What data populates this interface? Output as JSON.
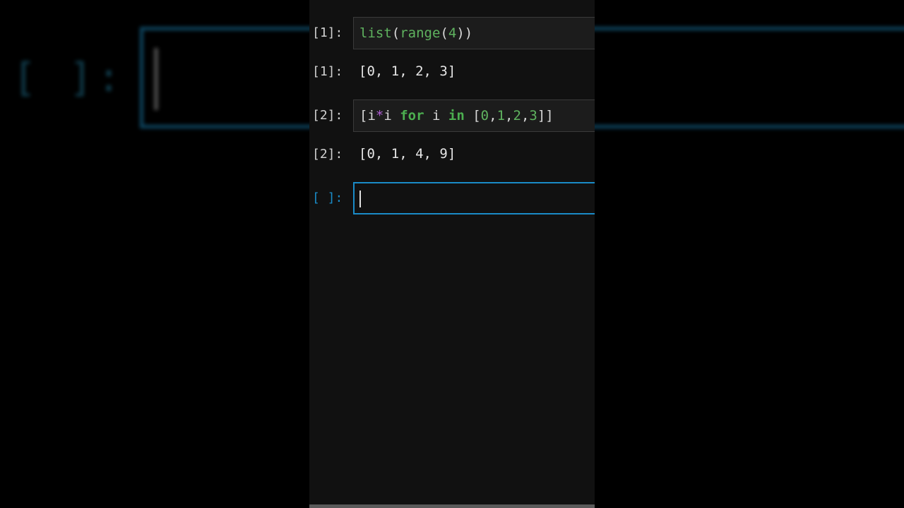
{
  "background": {
    "prompt": "[ ]:"
  },
  "cells": [
    {
      "input_prompt": "[1]:",
      "input_tokens": [
        {
          "text": "list",
          "cls": "tok-builtin"
        },
        {
          "text": "(",
          "cls": "tok-plain"
        },
        {
          "text": "range",
          "cls": "tok-builtin"
        },
        {
          "text": "(",
          "cls": "tok-plain"
        },
        {
          "text": "4",
          "cls": "tok-num"
        },
        {
          "text": "))",
          "cls": "tok-plain"
        }
      ],
      "output_prompt": "[1]:",
      "output": "[0, 1, 2, 3]"
    },
    {
      "input_prompt": "[2]:",
      "input_tokens": [
        {
          "text": "[i",
          "cls": "tok-plain"
        },
        {
          "text": "*",
          "cls": "tok-op"
        },
        {
          "text": "i ",
          "cls": "tok-plain"
        },
        {
          "text": "for",
          "cls": "tok-kw"
        },
        {
          "text": " i ",
          "cls": "tok-plain"
        },
        {
          "text": "in",
          "cls": "tok-kw"
        },
        {
          "text": " [",
          "cls": "tok-plain"
        },
        {
          "text": "0",
          "cls": "tok-num"
        },
        {
          "text": ",",
          "cls": "tok-plain"
        },
        {
          "text": "1",
          "cls": "tok-num"
        },
        {
          "text": ",",
          "cls": "tok-plain"
        },
        {
          "text": "2",
          "cls": "tok-num"
        },
        {
          "text": ",",
          "cls": "tok-plain"
        },
        {
          "text": "3",
          "cls": "tok-num"
        },
        {
          "text": "]]",
          "cls": "tok-plain"
        }
      ],
      "output_prompt": "[2]:",
      "output": "[0, 1, 4, 9]"
    }
  ],
  "active_cell": {
    "prompt": "[ ]:",
    "value": ""
  },
  "colors": {
    "accent": "#1a8bc7",
    "builtin": "#5fb35f",
    "keyword": "#4caf50",
    "operator": "#b15fd6",
    "background": "#111111"
  }
}
